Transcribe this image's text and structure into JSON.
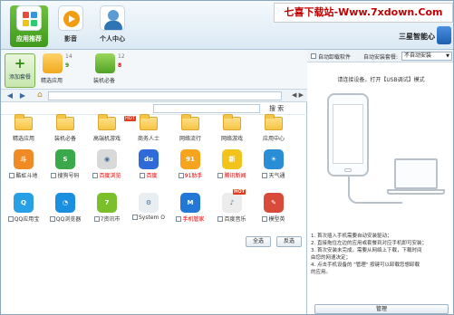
{
  "header": {
    "nav": [
      {
        "label": "应用推荐",
        "icon": "app-grid-icon",
        "active": true
      },
      {
        "label": "影音",
        "icon": "video-icon",
        "active": false
      },
      {
        "label": "个人中心",
        "icon": "person-icon",
        "active": false
      }
    ],
    "watermark": "七喜下载站-Www.7xdown.Com",
    "brand": "三星智能心"
  },
  "packages": {
    "add_label": "添加套餐",
    "items": [
      {
        "label": "精选应用",
        "total": "14",
        "down": "9",
        "up": null
      },
      {
        "label": "装机必备",
        "total": "12",
        "down": null,
        "up": "8"
      }
    ]
  },
  "search": {
    "placeholder": "",
    "button": "搜 索"
  },
  "folders": [
    {
      "label": "精选应用",
      "hot": false
    },
    {
      "label": "装机必备",
      "hot": false
    },
    {
      "label": "高端机游戏",
      "hot": true
    },
    {
      "label": "商务人士",
      "hot": false
    },
    {
      "label": "网络流行",
      "hot": false
    },
    {
      "label": "网络游戏",
      "hot": false
    },
    {
      "label": "应用中心",
      "hot": false
    }
  ],
  "apps": [
    {
      "name": "酷虹斗地",
      "red": false,
      "color": "#f08a24",
      "glyph": "斗",
      "hot": false
    },
    {
      "name": "搜狗号码",
      "red": false,
      "color": "#3ba94b",
      "glyph": "S",
      "hot": false
    },
    {
      "name": "百度浏览",
      "red": true,
      "color": "#d9d9d9",
      "glyph": "◉",
      "hot": false
    },
    {
      "name": "百度",
      "red": true,
      "color": "#2f6bd8",
      "glyph": "du",
      "hot": false
    },
    {
      "name": "91助手",
      "red": true,
      "color": "#f6a31e",
      "glyph": "91",
      "hot": false
    },
    {
      "name": "腾讯新闻",
      "red": true,
      "color": "#f2c31b",
      "glyph": "新",
      "hot": false
    },
    {
      "name": "天气通",
      "red": false,
      "color": "#2a8ed6",
      "glyph": "☀",
      "hot": false
    },
    {
      "name": "QQ应用宝",
      "red": false,
      "color": "#28a0e6",
      "glyph": "Q",
      "hot": false
    },
    {
      "name": "QQ浏览器",
      "red": false,
      "color": "#1a8fe0",
      "glyph": "◔",
      "hot": false
    },
    {
      "name": "7资讯市",
      "red": false,
      "color": "#7bbf2a",
      "glyph": "7",
      "hot": false
    },
    {
      "name": "System O",
      "red": false,
      "color": "#e9eef3",
      "glyph": "⚙",
      "hot": false
    },
    {
      "name": "手机管家",
      "red": true,
      "color": "#2377d6",
      "glyph": "M",
      "hot": false
    },
    {
      "name": "百度音乐",
      "red": false,
      "color": "#ececec",
      "glyph": "♪",
      "hot": true
    },
    {
      "name": "模型英",
      "red": false,
      "color": "#d84b3a",
      "glyph": "✎",
      "hot": false
    }
  ],
  "select_all": "全选",
  "select_inverse": "反选",
  "right": {
    "auto_uninstall": "自动卸载软件",
    "auto_install_label": "自动安装套餐:",
    "auto_install_value": "不自动安装",
    "connect_tip": "请连接设备，打开【USB调试】模式",
    "instructions": [
      "1. 首次插入手机需要自动安装驱动；",
      "2. 直接拖住左边的应用或套餐到对应手机即可安装；",
      "3. 首次安装未完成，需要从网络上下载，下载时间",
      "   由您的网速决定；",
      "4. 点击手机设备的 \"管理\" 按键可以卸载您想卸载",
      "   的应用。"
    ],
    "manage_btn": "管理"
  }
}
